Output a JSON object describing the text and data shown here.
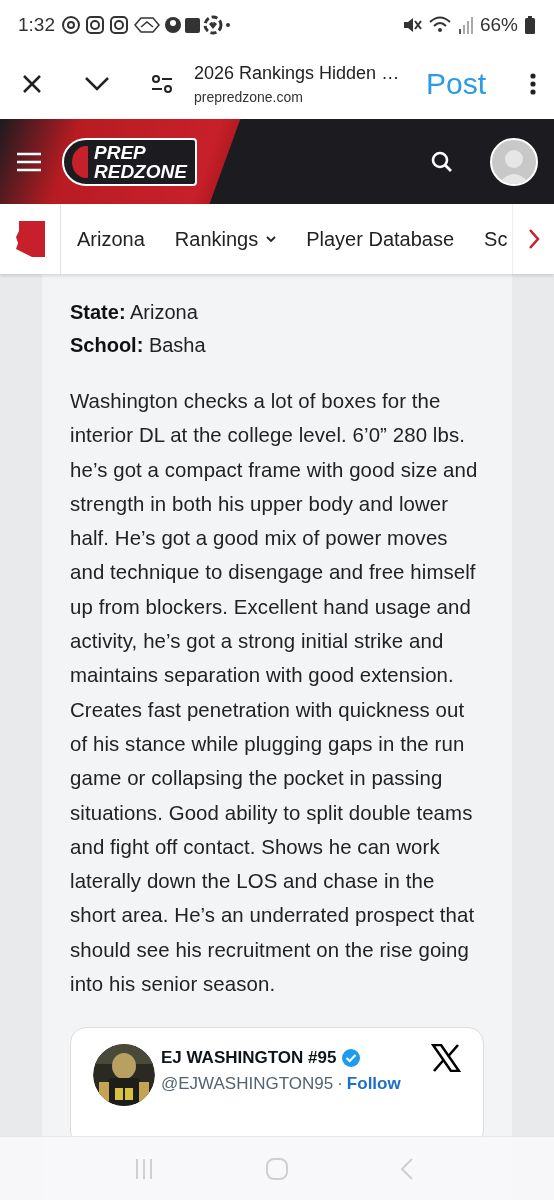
{
  "status_bar": {
    "time": "1:32",
    "battery": "66%"
  },
  "browser_bar": {
    "title": "2026 Rankings Hidden …",
    "domain": "prepredzone.com",
    "action": "Post"
  },
  "site_header": {
    "logo_lines": [
      "PREP",
      "REDZONE"
    ]
  },
  "nav": {
    "items": [
      {
        "label": "Arizona",
        "dropdown": false
      },
      {
        "label": "Rankings",
        "dropdown": true
      },
      {
        "label": "Player Database",
        "dropdown": false
      },
      {
        "label": "Sc",
        "dropdown": false
      }
    ]
  },
  "article": {
    "fields": [
      "**State:** Arizona",
      "**School:** Basha"
    ],
    "paragraph": "Washington checks a lot of boxes for the interior DL at the college level. 6’0” 280 lbs. he’s got a compact frame with good size and strength in both his upper body and lower half. He’s got a good mix of power moves and technique to disengage and free himself up from blockers. Excellent hand usage and activity, he’s got a strong initial strike and maintains separation with good extension. Creates fast penetration with quickness out of his stance while plugging gaps in the run game or collapsing the pocket in passing situations. Good ability to split double teams and fight off contact. Shows he can work laterally down the LOS and chase in the short area. He’s an underrated prospect that should see his recruitment on the rise going into his senior season."
  },
  "tweet": {
    "name": "EJ WASHINGTON #95",
    "verified": true,
    "handle": "@EJWASHINGTON95",
    "separator": "·",
    "follow": "Follow"
  }
}
